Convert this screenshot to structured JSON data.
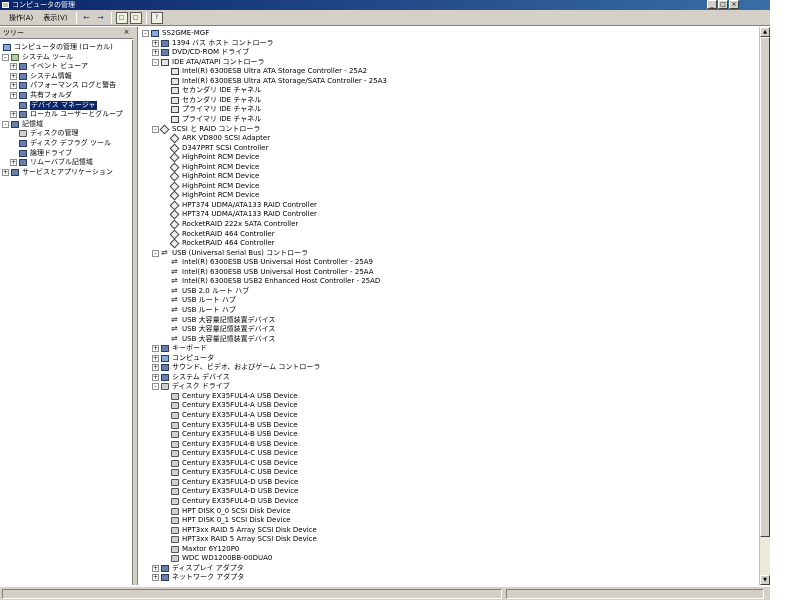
{
  "window": {
    "title": "コンピュータの管理",
    "controls": [
      "_",
      "□",
      "×"
    ]
  },
  "menu": [
    {
      "label": "操作(A)",
      "icon": "chevron-down-icon"
    },
    {
      "label": "表示(V)",
      "icon": "chevron-down-icon"
    }
  ],
  "toolbar": {
    "back": "←",
    "forward": "→",
    "up": "□",
    "show_tree": "□",
    "help": "?"
  },
  "tree_header": "ツリー",
  "tree_close": "×",
  "tree": [
    {
      "label": "コンピュータの管理 (ローカル)",
      "level": 0,
      "exp": "",
      "icon": "computer-icon"
    },
    {
      "label": "システム ツール",
      "level": 1,
      "exp": "-",
      "icon": "tools-icon"
    },
    {
      "label": "イベント ビューア",
      "level": 2,
      "exp": "+",
      "icon": "event-viewer-icon"
    },
    {
      "label": "システム情報",
      "level": 2,
      "exp": "+",
      "icon": "system-info-icon"
    },
    {
      "label": "パフォーマンス ログと警告",
      "level": 2,
      "exp": "+",
      "icon": "performance-icon"
    },
    {
      "label": "共有フォルダ",
      "level": 2,
      "exp": "+",
      "icon": "shared-folder-icon"
    },
    {
      "label": "デバイス マネージャ",
      "level": 2,
      "exp": "",
      "icon": "device-manager-icon",
      "selected": true
    },
    {
      "label": "ローカル ユーザーとグループ",
      "level": 2,
      "exp": "+",
      "icon": "users-icon"
    },
    {
      "label": "記憶域",
      "level": 1,
      "exp": "-",
      "icon": "storage-icon"
    },
    {
      "label": "ディスクの管理",
      "level": 2,
      "exp": "",
      "icon": "disk-management-icon"
    },
    {
      "label": "ディスク デフラグ ツール",
      "level": 2,
      "exp": "",
      "icon": "defrag-icon"
    },
    {
      "label": "論理ドライブ",
      "level": 2,
      "exp": "",
      "icon": "logical-drive-icon"
    },
    {
      "label": "リムーバブル記憶域",
      "level": 2,
      "exp": "+",
      "icon": "removable-storage-icon"
    },
    {
      "label": "サービスとアプリケーション",
      "level": 1,
      "exp": "+",
      "icon": "services-icon"
    }
  ],
  "devices": [
    {
      "label": "SS2GME-MGF",
      "level": 0,
      "exp": "-",
      "icon": "computer-icon"
    },
    {
      "label": "1394 バス ホスト コントローラ",
      "level": 1,
      "exp": "+",
      "icon": "category-icon"
    },
    {
      "label": "DVD/CD-ROM ドライブ",
      "level": 1,
      "exp": "+",
      "icon": "category-icon"
    },
    {
      "label": "IDE ATA/ATAPI コントローラ",
      "level": 1,
      "exp": "-",
      "icon": "ide-icon"
    },
    {
      "label": "Intel(R) 6300ESB Ultra ATA Storage Controller - 25A2",
      "level": 2,
      "exp": "",
      "icon": "ide-icon"
    },
    {
      "label": "Intel(R) 6300ESB Ultra ATA Storage/SATA Controller - 25A3",
      "level": 2,
      "exp": "",
      "icon": "ide-icon"
    },
    {
      "label": "セカンダリ IDE チャネル",
      "level": 2,
      "exp": "",
      "icon": "ide-icon"
    },
    {
      "label": "セカンダリ IDE チャネル",
      "level": 2,
      "exp": "",
      "icon": "ide-icon"
    },
    {
      "label": "プライマリ IDE チャネル",
      "level": 2,
      "exp": "",
      "icon": "ide-icon"
    },
    {
      "label": "プライマリ IDE チャネル",
      "level": 2,
      "exp": "",
      "icon": "ide-icon"
    },
    {
      "label": "SCSI と RAID コントローラ",
      "level": 1,
      "exp": "-",
      "icon": "scsi-icon"
    },
    {
      "label": "ARK VD800 SCSI Adapter",
      "level": 2,
      "exp": "",
      "icon": "scsi-icon"
    },
    {
      "label": "D347PRT SCSI Controller",
      "level": 2,
      "exp": "",
      "icon": "scsi-icon"
    },
    {
      "label": "HighPoint RCM Device",
      "level": 2,
      "exp": "",
      "icon": "scsi-icon"
    },
    {
      "label": "HighPoint RCM Device",
      "level": 2,
      "exp": "",
      "icon": "scsi-icon"
    },
    {
      "label": "HighPoint RCM Device",
      "level": 2,
      "exp": "",
      "icon": "scsi-icon"
    },
    {
      "label": "HighPoint RCM Device",
      "level": 2,
      "exp": "",
      "icon": "scsi-icon"
    },
    {
      "label": "HighPoint RCM Device",
      "level": 2,
      "exp": "",
      "icon": "scsi-icon"
    },
    {
      "label": "HPT374 UDMA/ATA133 RAID Controller",
      "level": 2,
      "exp": "",
      "icon": "scsi-icon"
    },
    {
      "label": "HPT374 UDMA/ATA133 RAID Controller",
      "level": 2,
      "exp": "",
      "icon": "scsi-icon"
    },
    {
      "label": "RocketRAID 222x SATA Controller",
      "level": 2,
      "exp": "",
      "icon": "scsi-icon"
    },
    {
      "label": "RocketRAID 464 Controller",
      "level": 2,
      "exp": "",
      "icon": "scsi-icon"
    },
    {
      "label": "RocketRAID 464 Controller",
      "level": 2,
      "exp": "",
      "icon": "scsi-icon"
    },
    {
      "label": "USB (Universal Serial Bus) コントローラ",
      "level": 1,
      "exp": "-",
      "icon": "usb-icon"
    },
    {
      "label": "Intel(R) 6300ESB USB Universal Host Controller - 25A9",
      "level": 2,
      "exp": "",
      "icon": "usb-icon"
    },
    {
      "label": "Intel(R) 6300ESB USB Universal Host Controller - 25AA",
      "level": 2,
      "exp": "",
      "icon": "usb-icon"
    },
    {
      "label": "Intel(R) 6300ESB USB2 Enhanced Host Controller - 25AD",
      "level": 2,
      "exp": "",
      "icon": "usb-icon"
    },
    {
      "label": "USB 2.0 ルート ハブ",
      "level": 2,
      "exp": "",
      "icon": "usb-icon"
    },
    {
      "label": "USB ルート ハブ",
      "level": 2,
      "exp": "",
      "icon": "usb-icon"
    },
    {
      "label": "USB ルート ハブ",
      "level": 2,
      "exp": "",
      "icon": "usb-icon"
    },
    {
      "label": "USB 大容量記憶装置デバイス",
      "level": 2,
      "exp": "",
      "icon": "usb-icon"
    },
    {
      "label": "USB 大容量記憶装置デバイス",
      "level": 2,
      "exp": "",
      "icon": "usb-icon"
    },
    {
      "label": "USB 大容量記憶装置デバイス",
      "level": 2,
      "exp": "",
      "icon": "usb-icon"
    },
    {
      "label": "キーボード",
      "level": 1,
      "exp": "+",
      "icon": "keyboard-icon"
    },
    {
      "label": "コンピュータ",
      "level": 1,
      "exp": "+",
      "icon": "computer-icon"
    },
    {
      "label": "サウンド、ビデオ、およびゲーム コントローラ",
      "level": 1,
      "exp": "+",
      "icon": "sound-icon"
    },
    {
      "label": "システム デバイス",
      "level": 1,
      "exp": "+",
      "icon": "category-icon"
    },
    {
      "label": "ディスク ドライブ",
      "level": 1,
      "exp": "-",
      "icon": "disk-icon"
    },
    {
      "label": "Century EX35FUL4-A USB Device",
      "level": 2,
      "exp": "",
      "icon": "disk-icon"
    },
    {
      "label": "Century EX35FUL4-A USB Device",
      "level": 2,
      "exp": "",
      "icon": "disk-icon"
    },
    {
      "label": "Century EX35FUL4-A USB Device",
      "level": 2,
      "exp": "",
      "icon": "disk-icon"
    },
    {
      "label": "Century EX35FUL4-B USB Device",
      "level": 2,
      "exp": "",
      "icon": "disk-icon"
    },
    {
      "label": "Century EX35FUL4-B USB Device",
      "level": 2,
      "exp": "",
      "icon": "disk-icon"
    },
    {
      "label": "Century EX35FUL4-B USB Device",
      "level": 2,
      "exp": "",
      "icon": "disk-icon"
    },
    {
      "label": "Century EX35FUL4-C USB Device",
      "level": 2,
      "exp": "",
      "icon": "disk-icon"
    },
    {
      "label": "Century EX35FUL4-C USB Device",
      "level": 2,
      "exp": "",
      "icon": "disk-icon"
    },
    {
      "label": "Century EX35FUL4-C USB Device",
      "level": 2,
      "exp": "",
      "icon": "disk-icon"
    },
    {
      "label": "Century EX35FUL4-D USB Device",
      "level": 2,
      "exp": "",
      "icon": "disk-icon"
    },
    {
      "label": "Century EX35FUL4-D USB Device",
      "level": 2,
      "exp": "",
      "icon": "disk-icon"
    },
    {
      "label": "Century EX35FUL4-D USB Device",
      "level": 2,
      "exp": "",
      "icon": "disk-icon"
    },
    {
      "label": "HPT DISK 0_0 SCSI Disk Device",
      "level": 2,
      "exp": "",
      "icon": "disk-icon"
    },
    {
      "label": "HPT DISK 0_1 SCSI Disk Device",
      "level": 2,
      "exp": "",
      "icon": "disk-icon"
    },
    {
      "label": "HPT3xx RAID 5 Array SCSI Disk Device",
      "level": 2,
      "exp": "",
      "icon": "disk-icon"
    },
    {
      "label": "HPT3xx RAID 5 Array SCSI Disk Device",
      "level": 2,
      "exp": "",
      "icon": "disk-icon"
    },
    {
      "label": "Maxtor 6Y120P0",
      "level": 2,
      "exp": "",
      "icon": "disk-icon"
    },
    {
      "label": "WDC WD1200BB-00DUA0",
      "level": 2,
      "exp": "",
      "icon": "disk-icon"
    },
    {
      "label": "ディスプレイ アダプタ",
      "level": 1,
      "exp": "+",
      "icon": "display-icon"
    },
    {
      "label": "ネットワーク アダプタ",
      "level": 1,
      "exp": "+",
      "icon": "network-icon"
    }
  ]
}
